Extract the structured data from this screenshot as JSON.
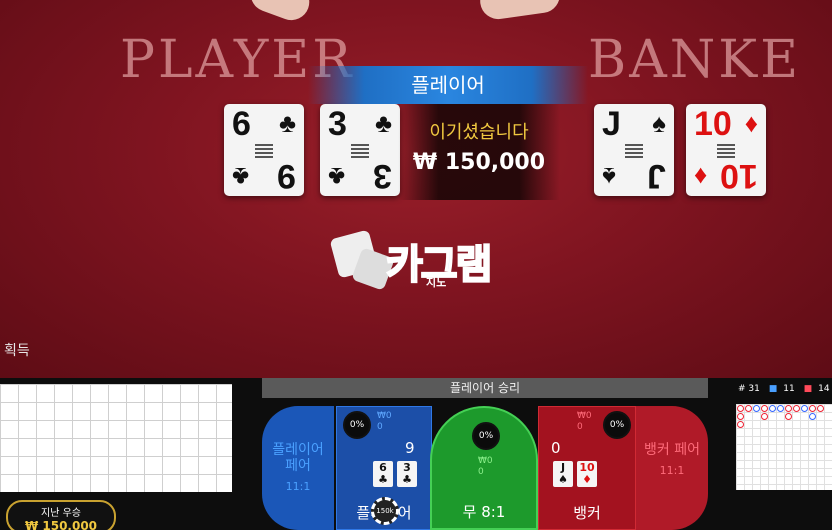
{
  "table": {
    "player_word": "PLAYER",
    "banker_word": "BANKE",
    "winner_banner": "플레이어",
    "win_text": "이기셨습니다",
    "win_amount": "₩ 150,000",
    "collect_label": "획득"
  },
  "cards": {
    "player": [
      {
        "rank": "6",
        "rank2": "9",
        "suit": "♣",
        "color": "black"
      },
      {
        "rank": "3",
        "rank2": "3",
        "suit": "♣",
        "color": "black"
      }
    ],
    "banker": [
      {
        "rank": "J",
        "rank2": "J",
        "suit": "♠",
        "color": "black"
      },
      {
        "rank": "10",
        "rank2": "10",
        "suit": "♦",
        "color": "red"
      }
    ]
  },
  "logo": {
    "text": "카그램",
    "sub": "지노"
  },
  "bottom": {
    "result_bar": "플레이어 승리",
    "last_win_label": "지난 우승",
    "last_win_amount": "₩ 150,000",
    "player_pair": {
      "label": "플레이어\n페어",
      "odds": "11:1"
    },
    "player": {
      "pct": "0%",
      "amount": "₩0",
      "people": "0",
      "score": "9",
      "label": "플레이어",
      "chip": "150k"
    },
    "tie": {
      "pct": "0%",
      "amount": "₩0",
      "people": "0",
      "label": "무 8:1"
    },
    "banker": {
      "pct": "0%",
      "amount": "₩0",
      "people": "0",
      "score": "0",
      "label": "뱅커"
    },
    "banker_pair": {
      "label": "뱅커 페어",
      "odds": "11:1"
    },
    "player_mini_cards": [
      {
        "text": "6\n♣",
        "color": "black"
      },
      {
        "text": "3\n♣",
        "color": "black"
      }
    ],
    "banker_mini_cards": [
      {
        "text": "J\n♠",
        "color": "black"
      },
      {
        "text": "10\n♦",
        "color": "red"
      }
    ],
    "scoreboard": {
      "total": "# 31",
      "player": "11",
      "banker": "14"
    }
  },
  "colors": {
    "player": "#1c4fa8",
    "banker": "#a3121f",
    "tie": "#1d9a2c",
    "gold": "#f0c840"
  }
}
